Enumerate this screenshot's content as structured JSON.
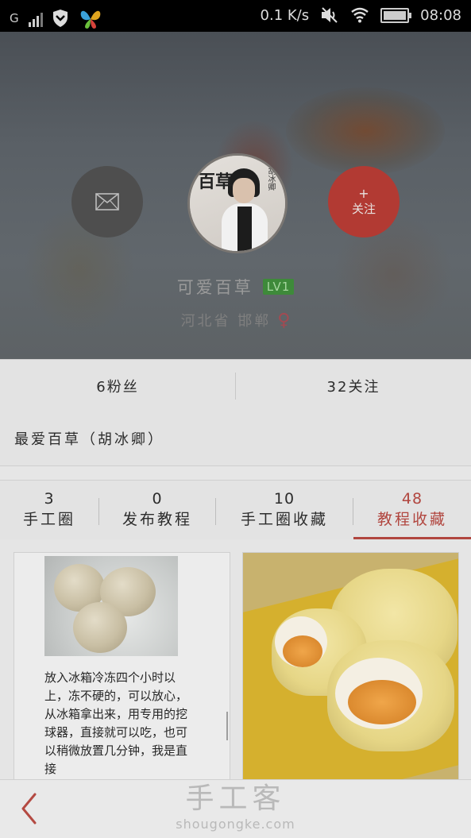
{
  "status_bar": {
    "carrier_mark": "G",
    "net_speed": "0.1 K/s",
    "time": "08:08",
    "icons": [
      "signal-icon",
      "shield-icon",
      "butterfly-app-icon",
      "mute-icon",
      "wifi-icon",
      "battery-icon"
    ]
  },
  "profile": {
    "username": "可爱百草",
    "level": "LV1",
    "location": "河北省 邯郸",
    "gender_symbol": "♀",
    "follow_label": "关注",
    "follow_plus": "+",
    "avatar_text": "百草",
    "avatar_caption": "胡冰卿"
  },
  "stats": {
    "fans": "6粉丝",
    "following": "32关注"
  },
  "signature": "最爱百草（胡冰卿）",
  "tabs": [
    {
      "count": "3",
      "label": "手工圈"
    },
    {
      "count": "0",
      "label": "发布教程"
    },
    {
      "count": "10",
      "label": "手工圈收藏"
    },
    {
      "count": "48",
      "label": "教程收藏"
    }
  ],
  "cards": [
    {
      "text": "放入冰箱冷冻四个小时以上，冻不硬的，可以放心，从冰箱拿出来，用专用的挖球器，直接就可以吃，也可以稍微放置几分钟，我是直接"
    },
    {
      "text": ""
    }
  ],
  "watermark": {
    "zh": "手工客",
    "en": "shougongke.com"
  },
  "colors": {
    "accent": "#b1463f",
    "level_badge": "#3e8a3a"
  }
}
